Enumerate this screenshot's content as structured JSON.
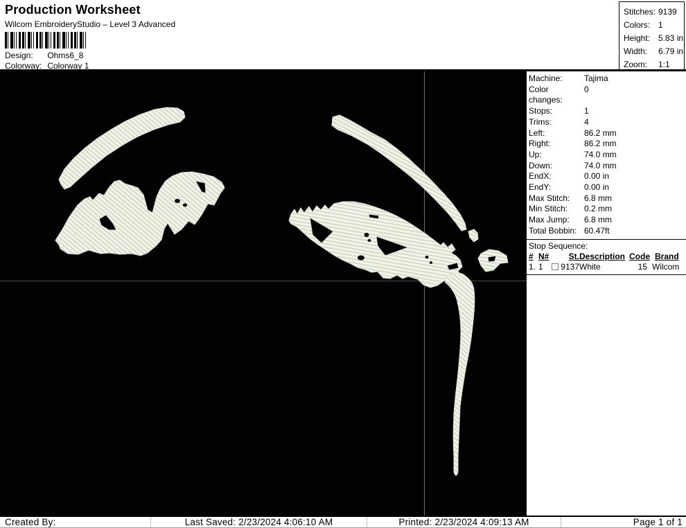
{
  "header": {
    "title": "Production Worksheet",
    "subtitle": "Wilcom EmbroideryStudio – Level 3 Advanced",
    "design_label": "Design:",
    "design_value": "Ohms6_8",
    "colorway_label": "Colorway:",
    "colorway_value": "Colorway 1",
    "stats": [
      {
        "label": "Stitches:",
        "value": "9139"
      },
      {
        "label": "Colors:",
        "value": "1"
      },
      {
        "label": "Height:",
        "value": "5.83 in"
      },
      {
        "label": "Width:",
        "value": "6.79 in"
      },
      {
        "label": "Zoom:",
        "value": "1:1"
      }
    ]
  },
  "machine_info": [
    {
      "label": "Machine:",
      "value": "Tajima"
    },
    {
      "label": "Color changes:",
      "value": "0"
    },
    {
      "label": "Stops:",
      "value": "1"
    },
    {
      "label": "Trims:",
      "value": "4"
    },
    {
      "label": "Left:",
      "value": "86.2 mm"
    },
    {
      "label": "Right:",
      "value": "86.2 mm"
    },
    {
      "label": "Up:",
      "value": "74.0 mm"
    },
    {
      "label": "Down:",
      "value": "74.0 mm"
    },
    {
      "label": "EndX:",
      "value": "0.00 in"
    },
    {
      "label": "EndY:",
      "value": "0.00 in"
    },
    {
      "label": "Max Stitch:",
      "value": "6.8 mm"
    },
    {
      "label": "Min Stitch:",
      "value": "0.2 mm"
    },
    {
      "label": "Max Jump:",
      "value": "6.8 mm"
    },
    {
      "label": "Total Bobbin:",
      "value": "60.47ft"
    }
  ],
  "stop_sequence": {
    "title": "Stop Sequence:",
    "columns": [
      "#",
      "N#",
      "St.",
      "Description",
      "Code",
      "Brand"
    ],
    "rows": [
      {
        "num": "1.",
        "n": "1",
        "st": "9137",
        "description": "White",
        "code": "15",
        "brand": "Wilcom"
      }
    ]
  },
  "canvas": {
    "background": "#020202",
    "thread_color": "#E9ECDF",
    "grid_horizontal_color": "#4D4D4D",
    "grid_vertical_color": "#6E6E6E",
    "design_subject": "eyes-embroidery-design"
  },
  "footer": {
    "created_by": "Created By:",
    "last_saved": "Last Saved: 2/23/2024 4:06:10 AM",
    "printed": "Printed: 2/23/2024 4:09:13 AM",
    "page": "Page 1 of 1"
  }
}
